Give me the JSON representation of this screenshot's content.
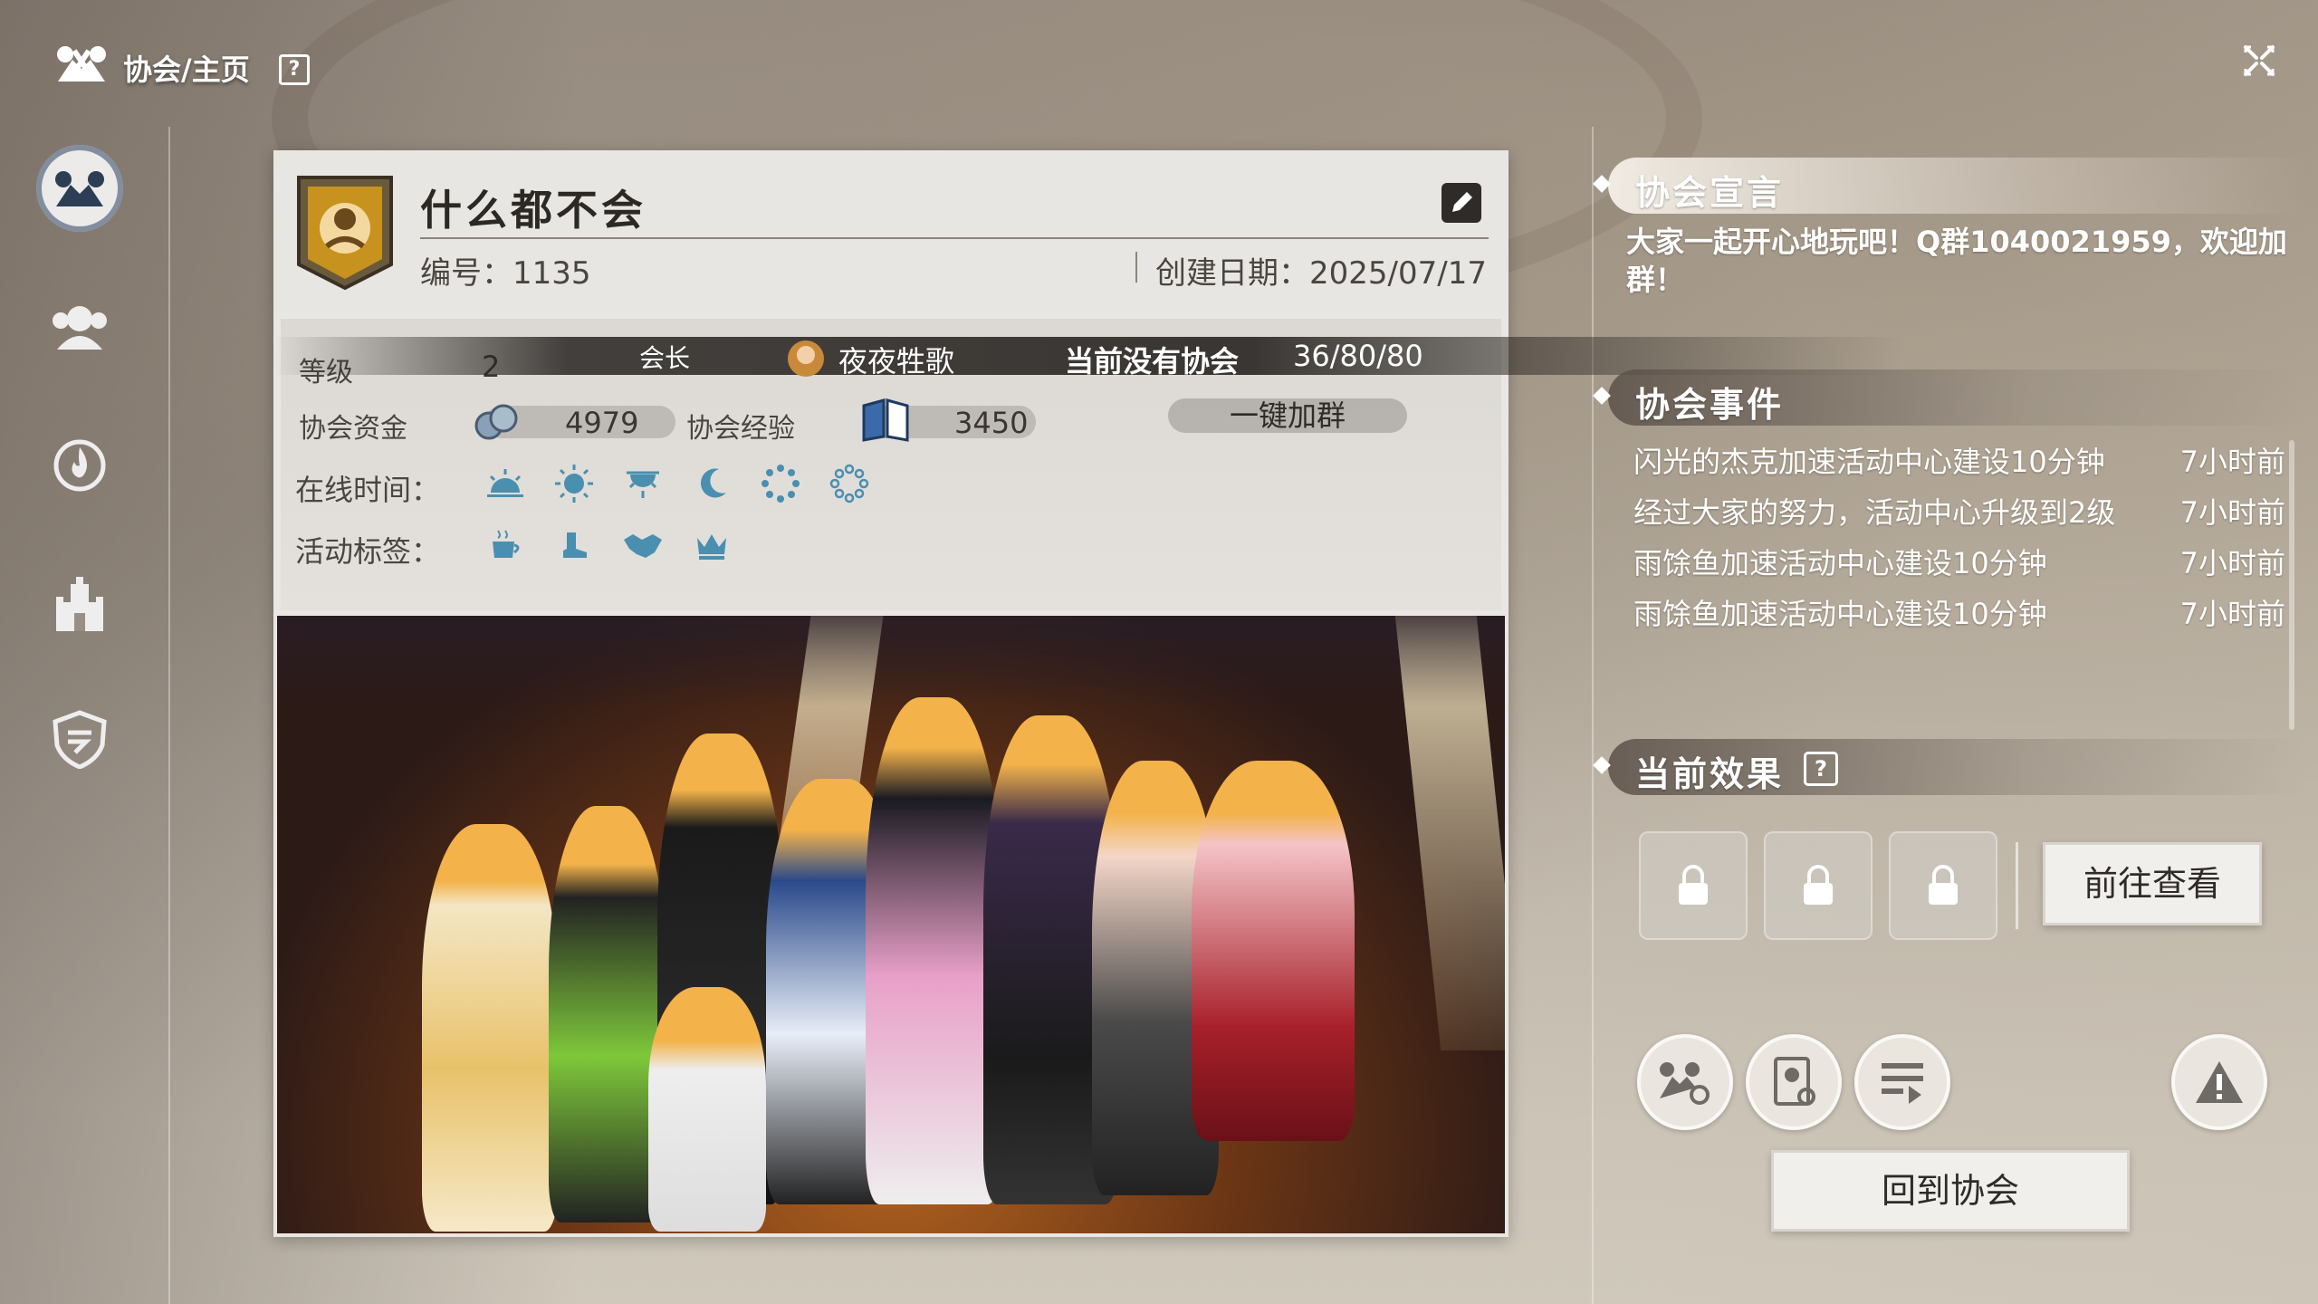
{
  "topbar": {
    "breadcrumb": "协会/主页",
    "help": "?"
  },
  "nav": {
    "items": [
      "guild-home",
      "members",
      "activity",
      "buildings",
      "shield"
    ]
  },
  "guild": {
    "name": "什么都不会",
    "id_text": "编号：1135",
    "created_text": "创建日期：2025/07/17",
    "level_label": "等级",
    "level_value": "2",
    "leader_label": "会长",
    "leader_name": "夜夜牲歌",
    "no_guild_text": "当前没有协会",
    "members_count": "36/80/80",
    "funds_label": "协会资金",
    "funds_value": "4979",
    "exp_label": "协会经验",
    "exp_value": "3450",
    "join_group_button": "一键加群",
    "online_label": "在线时间：",
    "tags_label": "活动标签："
  },
  "right": {
    "declaration_title": "协会宣言",
    "declaration_text": "大家一起开心地玩吧！Q群1040021959，欢迎加群！",
    "events_title": "协会事件",
    "events": [
      {
        "msg": "闪光的杰克加速活动中心建设10分钟",
        "time": "7小时前"
      },
      {
        "msg": "经过大家的努力，活动中心升级到2级",
        "time": "7小时前"
      },
      {
        "msg": "雨馀鱼加速活动中心建设10分钟",
        "time": "7小时前"
      },
      {
        "msg": "雨馀鱼加速活动中心建设10分钟",
        "time": "7小时前"
      }
    ],
    "effects_title": "当前效果",
    "effects_help": "?",
    "view_button": "前往查看",
    "return_button": "回到协会"
  },
  "colors": {
    "accent_dark": "#2e2b28",
    "card_bg": "#e9e7e3",
    "icon_teal": "#4a8fb0"
  }
}
